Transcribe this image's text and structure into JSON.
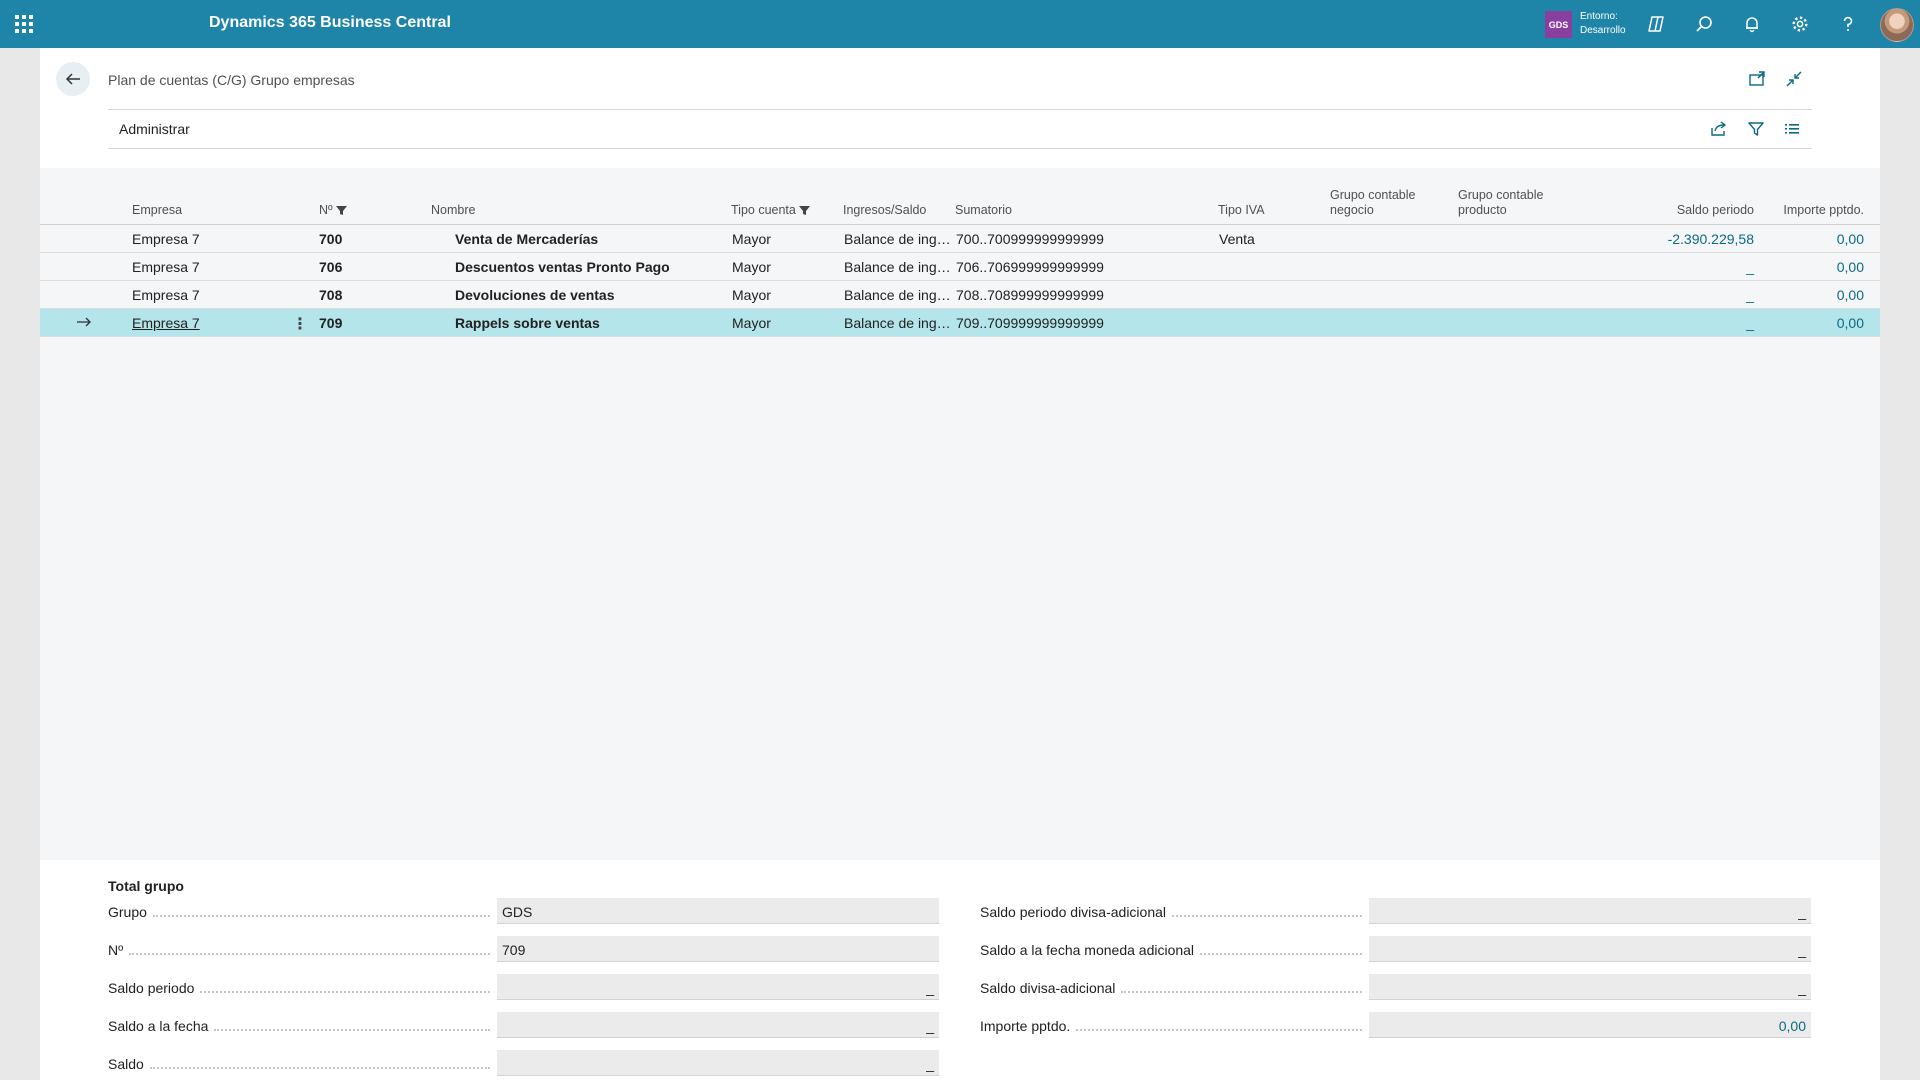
{
  "app": {
    "title": "Dynamics 365 Business Central",
    "badge": "GDS",
    "env_label": "Entorno:",
    "env_value": "Desarrollo",
    "icons": [
      "waffle-icon",
      "copilot-icon",
      "search-icon",
      "bell-icon",
      "gear-icon",
      "help-icon"
    ]
  },
  "page": {
    "breadcrumb": "Plan de cuentas (C/G) Grupo empresas",
    "action_admin": "Administrar"
  },
  "grid": {
    "headers": {
      "empresa": "Empresa",
      "no": "Nº",
      "nombre": "Nombre",
      "tipo_cuenta": "Tipo cuenta",
      "ingresos_saldo": "Ingresos/Saldo",
      "sumatorio": "Sumatorio",
      "tipo_iva": "Tipo IVA",
      "grupo_negocio_1": "Grupo contable",
      "grupo_negocio_2": "negocio",
      "grupo_producto_1": "Grupo contable",
      "grupo_producto_2": "producto",
      "saldo_periodo": "Saldo periodo",
      "importe_pptdo": "Importe pptdo."
    },
    "rows": [
      {
        "empresa": "Empresa 7",
        "no": "700",
        "nombre": "Venta de Mercaderías",
        "tipo_cuenta": "Mayor",
        "ingresos_saldo": "Balance de ingr...",
        "sumatorio": "700..700999999999999",
        "tipo_iva": "Venta",
        "saldo_periodo": "-2.390.229,58",
        "importe_pptdo": "0,00"
      },
      {
        "empresa": "Empresa 7",
        "no": "706",
        "nombre": "Descuentos ventas Pronto Pago",
        "tipo_cuenta": "Mayor",
        "ingresos_saldo": "Balance de ingr...",
        "sumatorio": "706..706999999999999",
        "tipo_iva": "",
        "saldo_periodo": "_",
        "importe_pptdo": "0,00"
      },
      {
        "empresa": "Empresa 7",
        "no": "708",
        "nombre": "Devoluciones de ventas",
        "tipo_cuenta": "Mayor",
        "ingresos_saldo": "Balance de ingr...",
        "sumatorio": "708..708999999999999",
        "tipo_iva": "",
        "saldo_periodo": "_",
        "importe_pptdo": "0,00"
      },
      {
        "empresa": "Empresa 7",
        "no": "709",
        "nombre": "Rappels sobre ventas",
        "tipo_cuenta": "Mayor",
        "ingresos_saldo": "Balance de ingr...",
        "sumatorio": "709..709999999999999",
        "tipo_iva": "",
        "saldo_periodo": "_",
        "importe_pptdo": "0,00"
      }
    ]
  },
  "totals": {
    "title": "Total grupo",
    "left": [
      {
        "label": "Grupo",
        "value": "GDS"
      },
      {
        "label": "Nº",
        "value": "709"
      },
      {
        "label": "Saldo periodo",
        "value": "_"
      },
      {
        "label": "Saldo a la fecha",
        "value": "_"
      },
      {
        "label": "Saldo",
        "value": "_"
      }
    ],
    "right": [
      {
        "label": "Saldo periodo divisa-adicional",
        "value": "_"
      },
      {
        "label": "Saldo a la fecha moneda adicional",
        "value": "_"
      },
      {
        "label": "Saldo divisa-adicional",
        "value": "_"
      },
      {
        "label": "Importe pptdo.",
        "value": "0,00"
      }
    ]
  },
  "colors": {
    "appbar": "#1f85a8",
    "selected_row": "#b3e5ea",
    "number_link": "#0b6a83",
    "badge": "#8a3fa0"
  }
}
